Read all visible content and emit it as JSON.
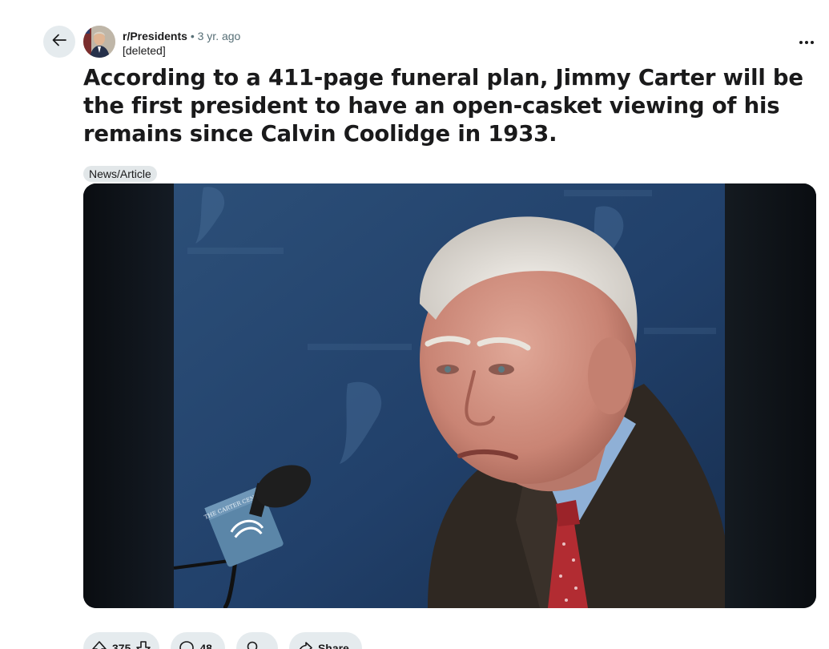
{
  "post": {
    "subreddit": "r/Presidents",
    "separator": "•",
    "time_ago": "3 yr. ago",
    "author": "[deleted]",
    "title": "According to a 411-page funeral plan, Jimmy Carter will be the first president to have an open-casket viewing of his remains since Calvin Coolidge in 1933.",
    "flair": "News/Article",
    "image_podium_text": "THE CARTER CENTER"
  },
  "actions": {
    "upvote_count": "375",
    "comment_count": "48",
    "award_label": "",
    "share_label": "Share"
  },
  "icons": {
    "back": "arrow-left-icon",
    "more": "more-horizontal-icon",
    "upvote": "upvote-arrow-icon",
    "downvote": "downvote-arrow-icon",
    "comment": "speech-bubble-icon",
    "award": "award-icon",
    "share": "share-arrow-icon"
  },
  "colors": {
    "pill_bg": "#e5ebee",
    "flair_bg": "#e2e7e9",
    "meta_gray": "#576f76",
    "text": "#1a1a1b"
  }
}
